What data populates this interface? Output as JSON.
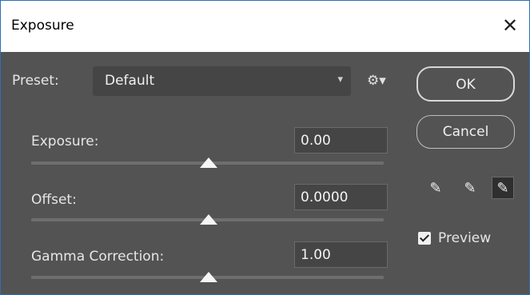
{
  "window": {
    "title": "Exposure"
  },
  "preset": {
    "label": "Preset:",
    "value": "Default"
  },
  "controls": [
    {
      "label": "Exposure:",
      "value": "0.00",
      "slider_level": 0.5
    },
    {
      "label": "Offset:",
      "value": "0.0000",
      "slider_level": 0.5
    },
    {
      "label": "Gamma Correction:",
      "value": "1.00",
      "slider_level": 0.5
    }
  ],
  "buttons": {
    "ok": "OK",
    "cancel": "Cancel"
  },
  "preview": {
    "label": "Preview",
    "checked": true
  },
  "icons": {
    "close": "close-icon",
    "gear": "gear-icon",
    "chevron": "chevron-down-icon",
    "eyedroppers": [
      "eyedropper-black-point-icon",
      "eyedropper-gray-point-icon",
      "eyedropper-white-point-icon"
    ]
  },
  "colors": {
    "window_bg": "#535353",
    "field_bg": "#454545",
    "title_bg": "#ffffff",
    "accent_border": "#2b6fb6"
  }
}
